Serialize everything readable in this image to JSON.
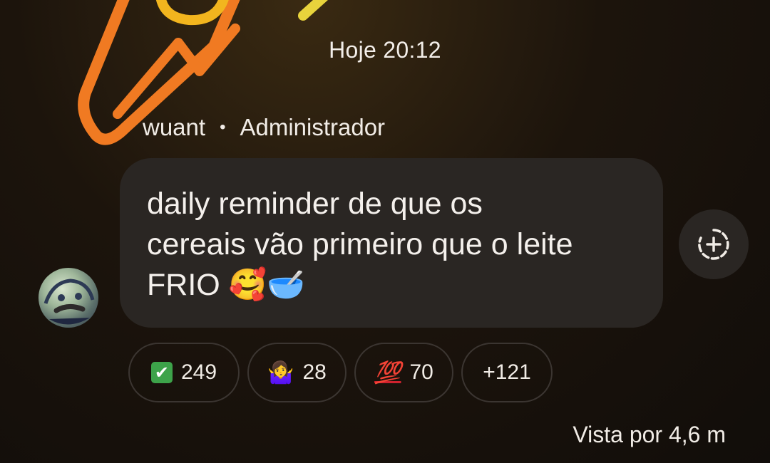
{
  "chat": {
    "timestamp": "Hoje 20:12",
    "message": {
      "sender_name": "wuant",
      "separator": "•",
      "sender_role": "Administrador",
      "text_line1": "daily reminder de que os",
      "text_line2": "cereais vão primeiro que o leite",
      "text_line3": "FRIO 🥰🥣"
    },
    "reactions": [
      {
        "emoji": "✔",
        "icon": "check-mark-emoji",
        "count": "249"
      },
      {
        "emoji": "🤷‍♀️",
        "icon": "person-shrugging-emoji",
        "count": "28"
      },
      {
        "emoji": "💯",
        "icon": "hundred-points-emoji",
        "count": "70"
      }
    ],
    "more_reactions": "+121",
    "views": "Vista por 4,6 m",
    "add_reaction_icon": "add-reaction-icon"
  },
  "colors": {
    "bubble": "#2a2623",
    "background": "#110d0a",
    "neon_orange": "#f07a22",
    "neon_yellow": "#f2b51e",
    "check_green": "#3da34a"
  }
}
